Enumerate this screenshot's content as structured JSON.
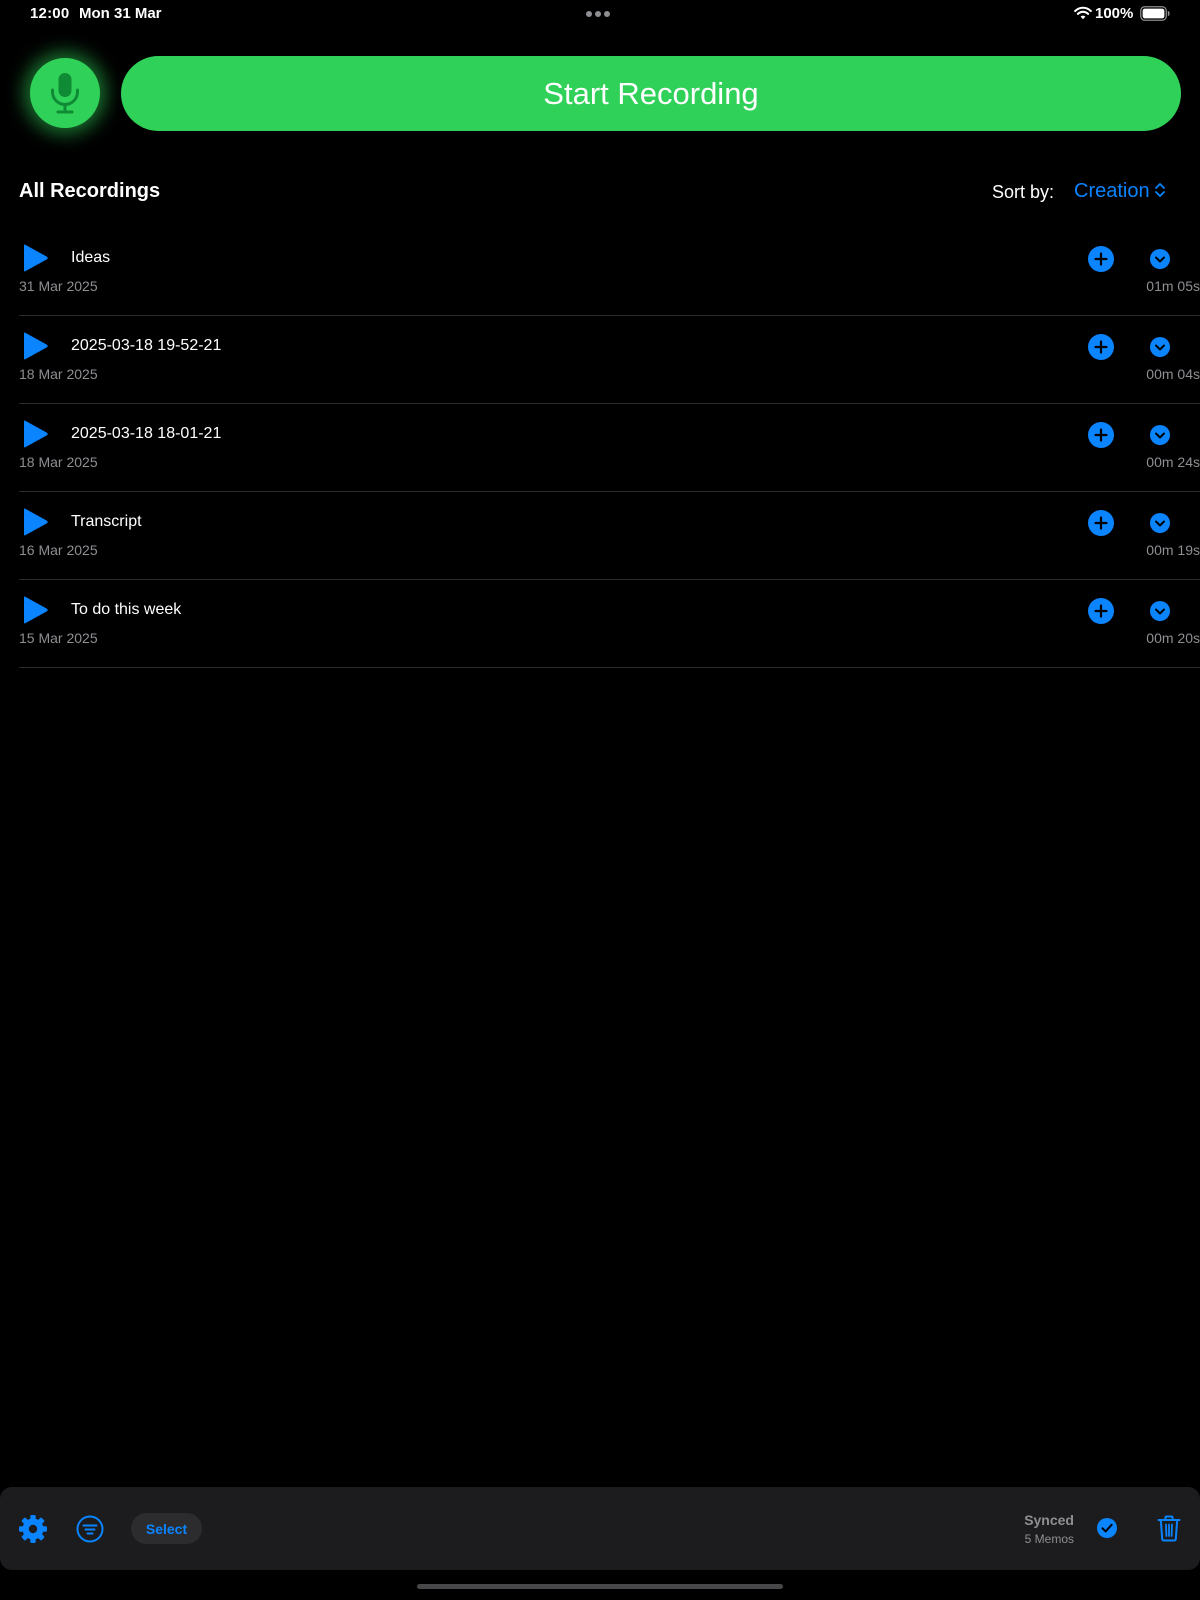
{
  "status_bar": {
    "time": "12:00",
    "date": "Mon 31 Mar",
    "battery": "100%"
  },
  "record": {
    "button_label": "Start Recording"
  },
  "list_header": {
    "title": "All Recordings",
    "sort_label": "Sort by:",
    "sort_value": "Creation"
  },
  "recordings": [
    {
      "title": "Ideas",
      "date": "31 Mar 2025",
      "duration": "01m 05s"
    },
    {
      "title": "2025-03-18 19-52-21",
      "date": "18 Mar 2025",
      "duration": "00m 04s"
    },
    {
      "title": "2025-03-18 18-01-21",
      "date": "18 Mar 2025",
      "duration": "00m 24s"
    },
    {
      "title": "Transcript",
      "date": "16 Mar 2025",
      "duration": "00m 19s"
    },
    {
      "title": "To do this week",
      "date": "15 Mar 2025",
      "duration": "00m 20s"
    }
  ],
  "toolbar": {
    "select_label": "Select",
    "sync_status": "Synced",
    "sync_count": "5 Memos"
  },
  "icons": {
    "mic": "microphone-icon",
    "play": "play-icon",
    "add": "plus-circle-icon",
    "expand": "chevron-down-circle-icon",
    "settings": "gear-icon",
    "filter": "filter-icon",
    "synced": "checkmark-circle-icon",
    "trash": "trash-icon",
    "wifi": "wifi-icon",
    "battery": "battery-icon"
  },
  "colors": {
    "background": "#000000",
    "record_green": "#30d158",
    "accent_blue": "#0a84ff",
    "secondary_text": "#8e8e93",
    "toolbar_bg": "#1c1c1e"
  }
}
